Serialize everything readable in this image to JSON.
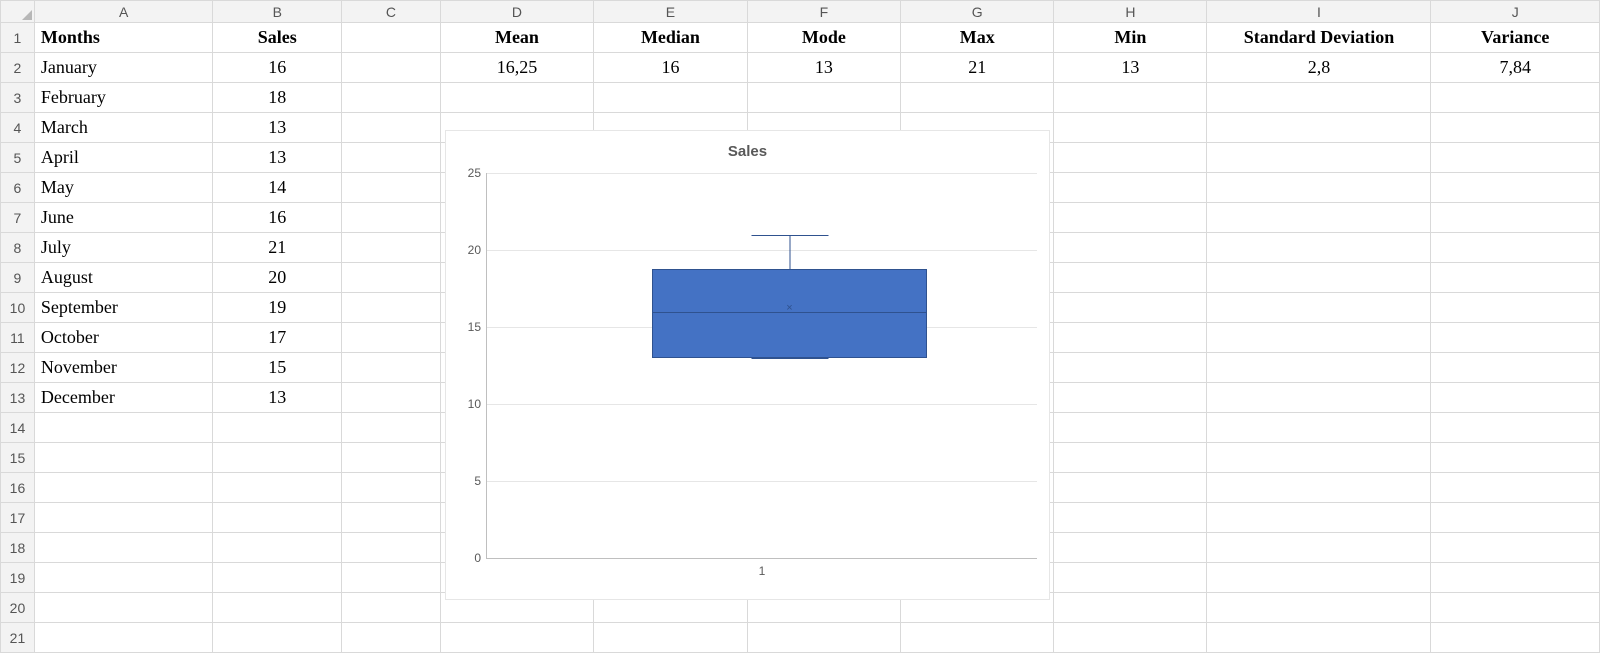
{
  "columns": [
    "A",
    "B",
    "C",
    "D",
    "E",
    "F",
    "G",
    "H",
    "I",
    "J"
  ],
  "row_count": 21,
  "headers": {
    "A1": "Months",
    "B1": "Sales",
    "D1": "Mean",
    "E1": "Median",
    "F1": "Mode",
    "G1": "Max",
    "H1": "Min",
    "I1": "Standard Deviation",
    "J1": "Variance"
  },
  "stats": {
    "mean": "16,25",
    "median": "16",
    "mode": "13",
    "max": "21",
    "min": "13",
    "stddev": "2,8",
    "variance": "7,84"
  },
  "months_data": [
    {
      "month": "January",
      "sales": "16"
    },
    {
      "month": "February",
      "sales": "18"
    },
    {
      "month": "March",
      "sales": "13"
    },
    {
      "month": "April",
      "sales": "13"
    },
    {
      "month": "May",
      "sales": "14"
    },
    {
      "month": "June",
      "sales": "16"
    },
    {
      "month": "July",
      "sales": "21"
    },
    {
      "month": "August",
      "sales": "20"
    },
    {
      "month": "September",
      "sales": "19"
    },
    {
      "month": "October",
      "sales": "17"
    },
    {
      "month": "November",
      "sales": "15"
    },
    {
      "month": "December",
      "sales": "13"
    }
  ],
  "chart_data": {
    "type": "boxplot",
    "title": "Sales",
    "x_categories": [
      "1"
    ],
    "ylim": [
      0,
      25
    ],
    "yticks": [
      0,
      5,
      10,
      15,
      20,
      25
    ],
    "series": [
      {
        "name": "Sales",
        "min": 13,
        "q1": 13,
        "median": 16,
        "mean": 16.25,
        "q3": 18.75,
        "max": 21
      }
    ]
  }
}
